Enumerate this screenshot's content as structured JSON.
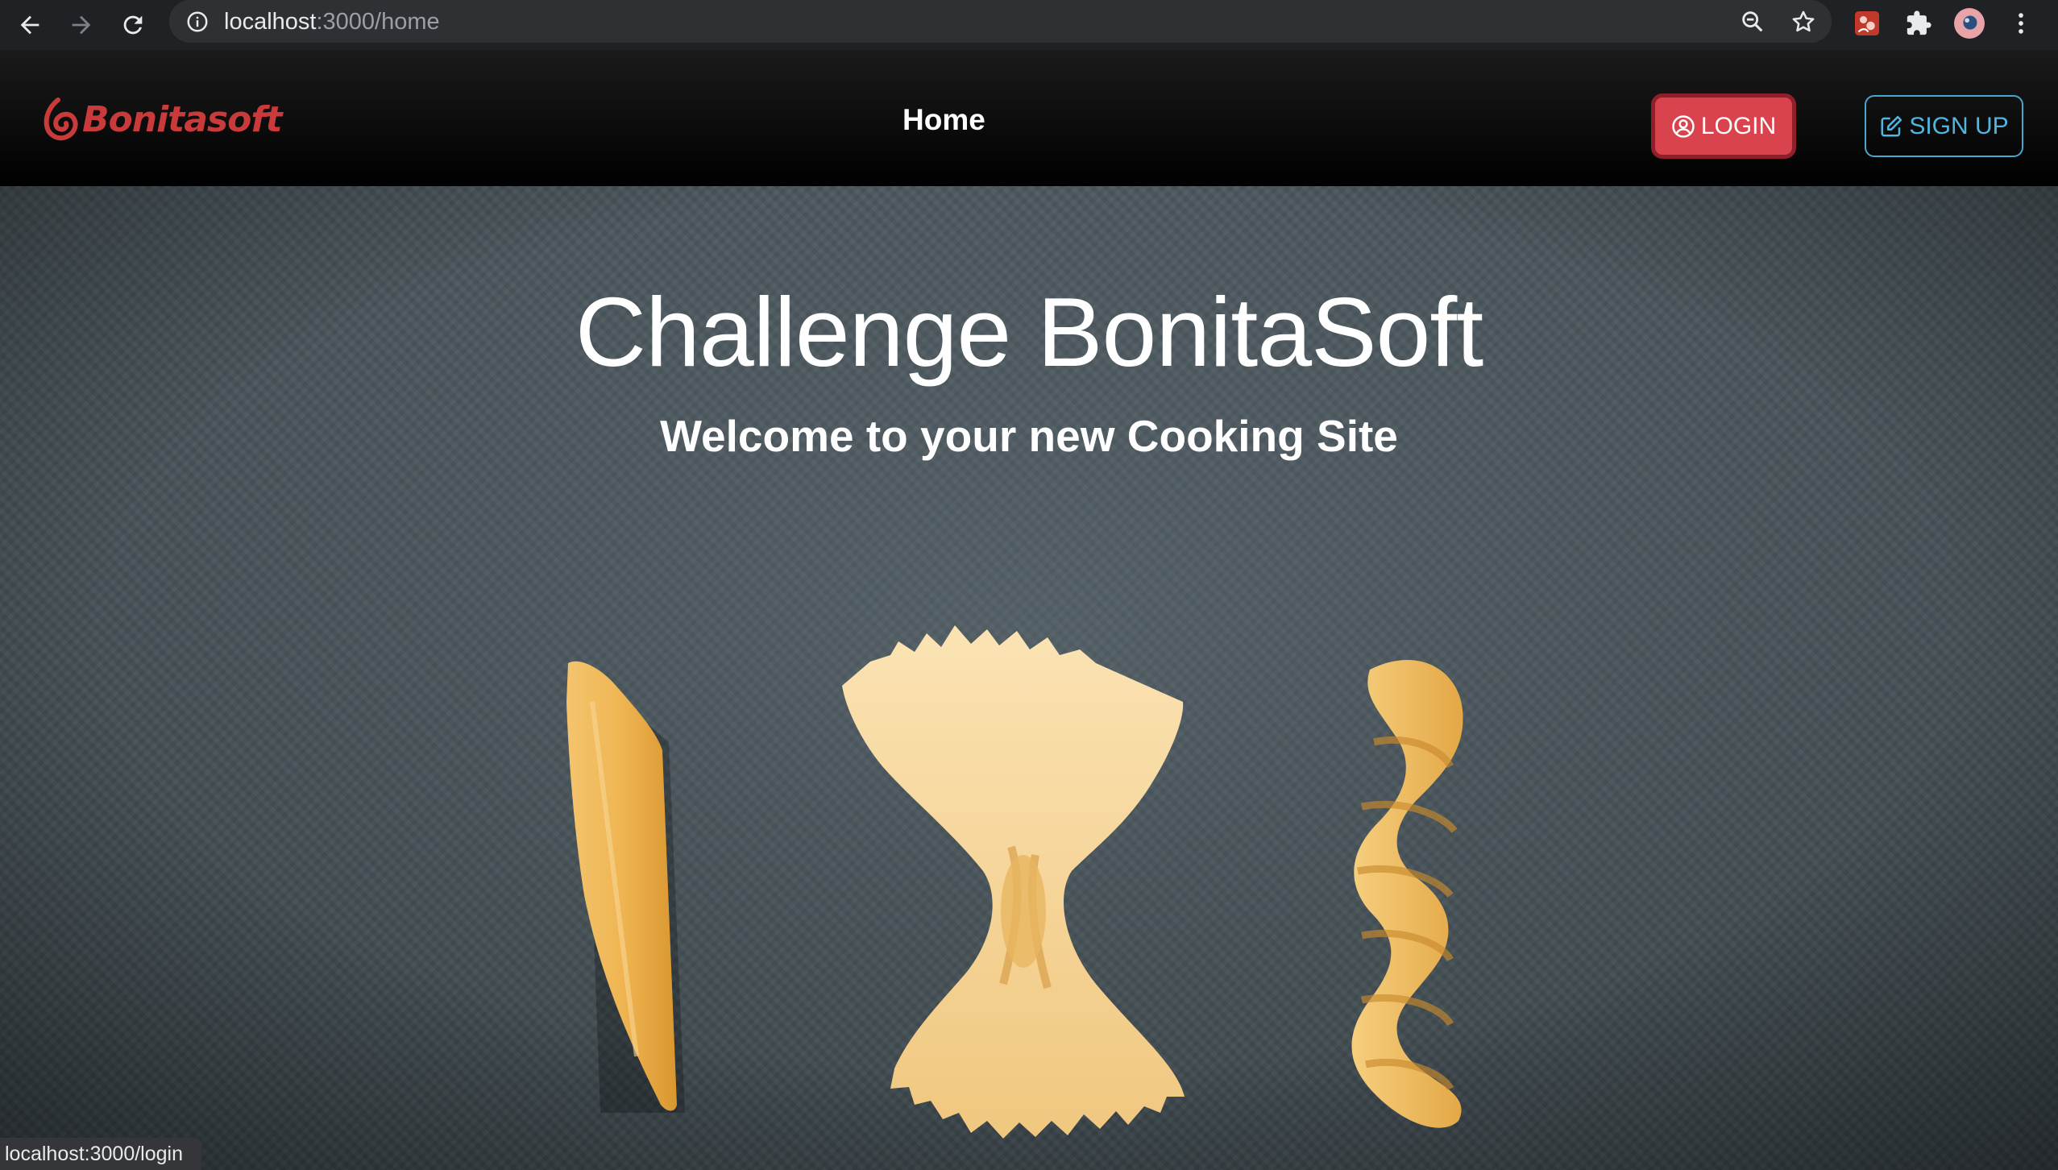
{
  "browser": {
    "url_host": "localhost",
    "url_path": ":3000/home",
    "icons": [
      "back-icon",
      "forward-icon",
      "reload-icon",
      "site-info-icon",
      "zoom-icon",
      "bookmark-star-icon",
      "extension-icon",
      "puzzle-extensions-icon",
      "profile-avatar",
      "more-menu-icon"
    ]
  },
  "navbar": {
    "brand": "Bonitasoft",
    "home_link": "Home",
    "login_label": "LOGIN",
    "signup_label": "SIGN UP"
  },
  "hero": {
    "title": "Challenge BonitaSoft",
    "subtitle": "Welcome to your new Cooking Site"
  },
  "status_bar": {
    "link_preview": "localhost:3000/login"
  },
  "colors": {
    "login_bg": "#d8434e",
    "signup_accent": "#4fb6df",
    "brand_red": "#c93a3a"
  }
}
